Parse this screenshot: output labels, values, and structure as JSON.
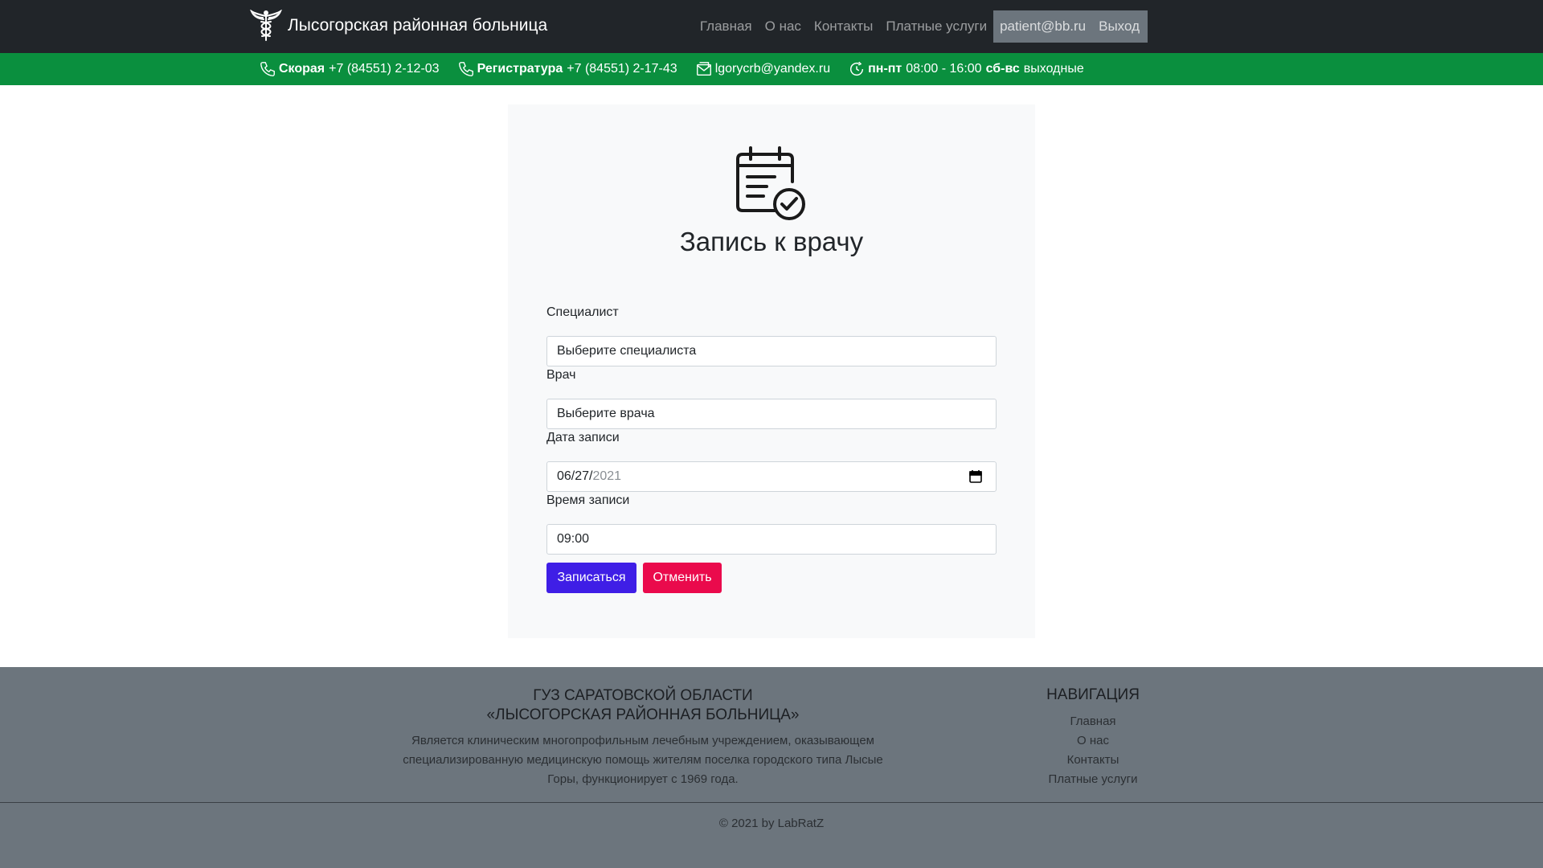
{
  "header": {
    "brand": "Лысогорская районная больница",
    "nav": [
      "Главная",
      "О нас",
      "Контакты",
      "Платные услуги"
    ],
    "user_email": "patient@bb.ru",
    "logout": "Выход"
  },
  "contacts": {
    "ambulance_label": "Скорая",
    "ambulance_phone": "+7 (84551) 2-12-03",
    "registry_label": "Регистратура",
    "registry_phone": "+7 (84551) 2-17-43",
    "email": "lgorycrb@yandex.ru",
    "weekdays_label": "пн-пт",
    "weekdays_hours": "08:00 - 16:00",
    "weekend_label": "сб-вс",
    "weekend_text": "выходные"
  },
  "form": {
    "title": "Запись к врачу",
    "specialist_label": "Специалист",
    "specialist_value": "Выберите специалиста",
    "doctor_label": "Врач",
    "doctor_value": "Выберите врача",
    "date_label": "Дата записи",
    "date_value_part": "06/27/",
    "date_year_part": "2021",
    "time_label": "Время записи",
    "time_value": "09:00",
    "submit": "Записаться",
    "cancel": "Отменить"
  },
  "footer": {
    "title_line1": "ГУЗ Саратовской области",
    "title_line2": "«Лысогорская районная больница»",
    "description": "Является клиническим многопрофильным лечебным учреждением, оказывающем специализированную медицинскую помощь жителям поселка городского типа Лысые Горы, функционирует с 1969 года.",
    "nav_title": "Навигация",
    "nav": [
      "Главная",
      "О нас",
      "Контакты",
      "Платные услуги"
    ],
    "copyright": "© 2021 by LabRatZ"
  },
  "colors": {
    "navbar": "#212529",
    "contact_bar": "#0a8f3e",
    "card": "#f8f9fa",
    "primary_button": "#3f1ee6",
    "danger_button": "#ea0a4c",
    "footer": "#6c757d"
  },
  "icons": [
    "caduceus-logo-icon",
    "phone-icon",
    "mail-icon",
    "clock-icon",
    "calendar-check-icon",
    "calendar-icon"
  ]
}
